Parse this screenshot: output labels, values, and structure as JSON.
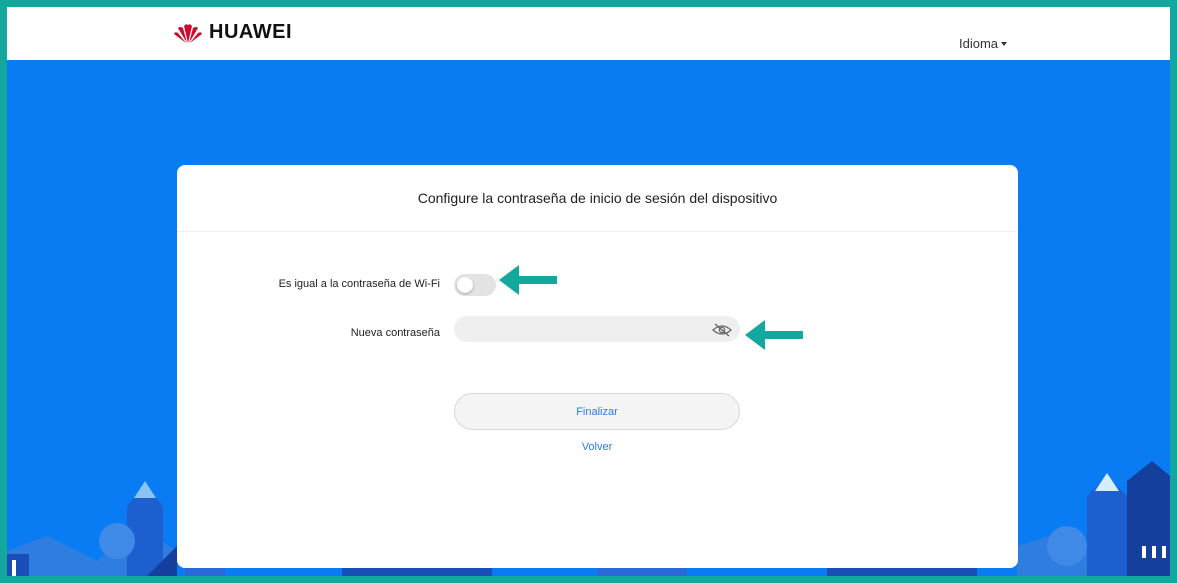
{
  "header": {
    "brand": "HUAWEI",
    "language_label": "Idioma"
  },
  "card": {
    "title": "Configure la contraseña de inicio de sesión del dispositivo",
    "same_as_wifi_label": "Es igual a la contraseña de Wi-Fi",
    "same_as_wifi_enabled": false,
    "new_password_label": "Nueva contraseña",
    "new_password_value": "",
    "finish_label": "Finalizar",
    "back_label": "Volver"
  },
  "colors": {
    "background": "#0a7cf3",
    "frame_border": "#13a89e",
    "annotation_arrow": "#13a89e",
    "link": "#2c7be5",
    "brand_red": "#cf0a2c"
  },
  "icons": [
    "huawei-logo-icon",
    "chevron-down-icon",
    "eye-hidden-icon",
    "arrow-left-icon"
  ]
}
